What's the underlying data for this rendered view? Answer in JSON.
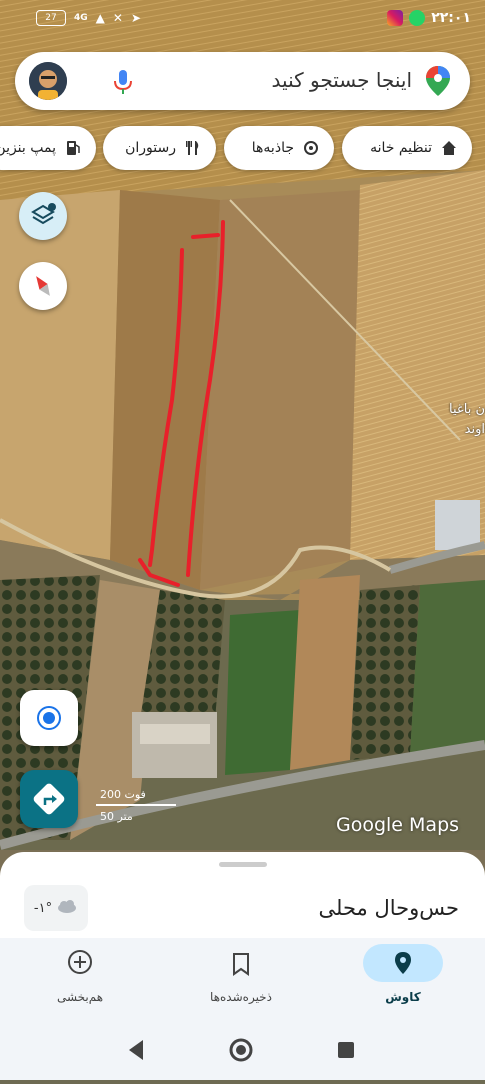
{
  "status_bar": {
    "time": "۲۲:۰۱",
    "battery": "27",
    "network": "4G"
  },
  "search": {
    "placeholder": "اینجا جستجو کنید"
  },
  "chips": [
    {
      "label": "تنظیم خانه",
      "icon": "home-icon"
    },
    {
      "label": "جاذبه‌ها",
      "icon": "attraction-icon"
    },
    {
      "label": "رستوران",
      "icon": "restaurant-icon"
    },
    {
      "label": "پمپ بنزین",
      "icon": "gas-station-icon"
    }
  ],
  "map": {
    "place_label_line1": "ن باغیا",
    "place_label_line2": "اوند",
    "scale_ft": "200 فوت",
    "scale_m": "50 متر",
    "brand": "Google Maps",
    "annotation_color": "#e8202a"
  },
  "sheet": {
    "title": "حس‌وحال محلی",
    "temperature": "-۱°"
  },
  "bottom_nav": [
    {
      "label": "کاوش",
      "icon": "explore-pin-icon",
      "active": true
    },
    {
      "label": "ذخیره‌شده‌ها",
      "icon": "bookmark-icon",
      "active": false
    },
    {
      "label": "هم‌بخشی",
      "icon": "add-circle-icon",
      "active": false
    }
  ],
  "colors": {
    "accent": "#1a73e8",
    "teal": "#0b7285",
    "nav_active": "#c2e7ff"
  }
}
